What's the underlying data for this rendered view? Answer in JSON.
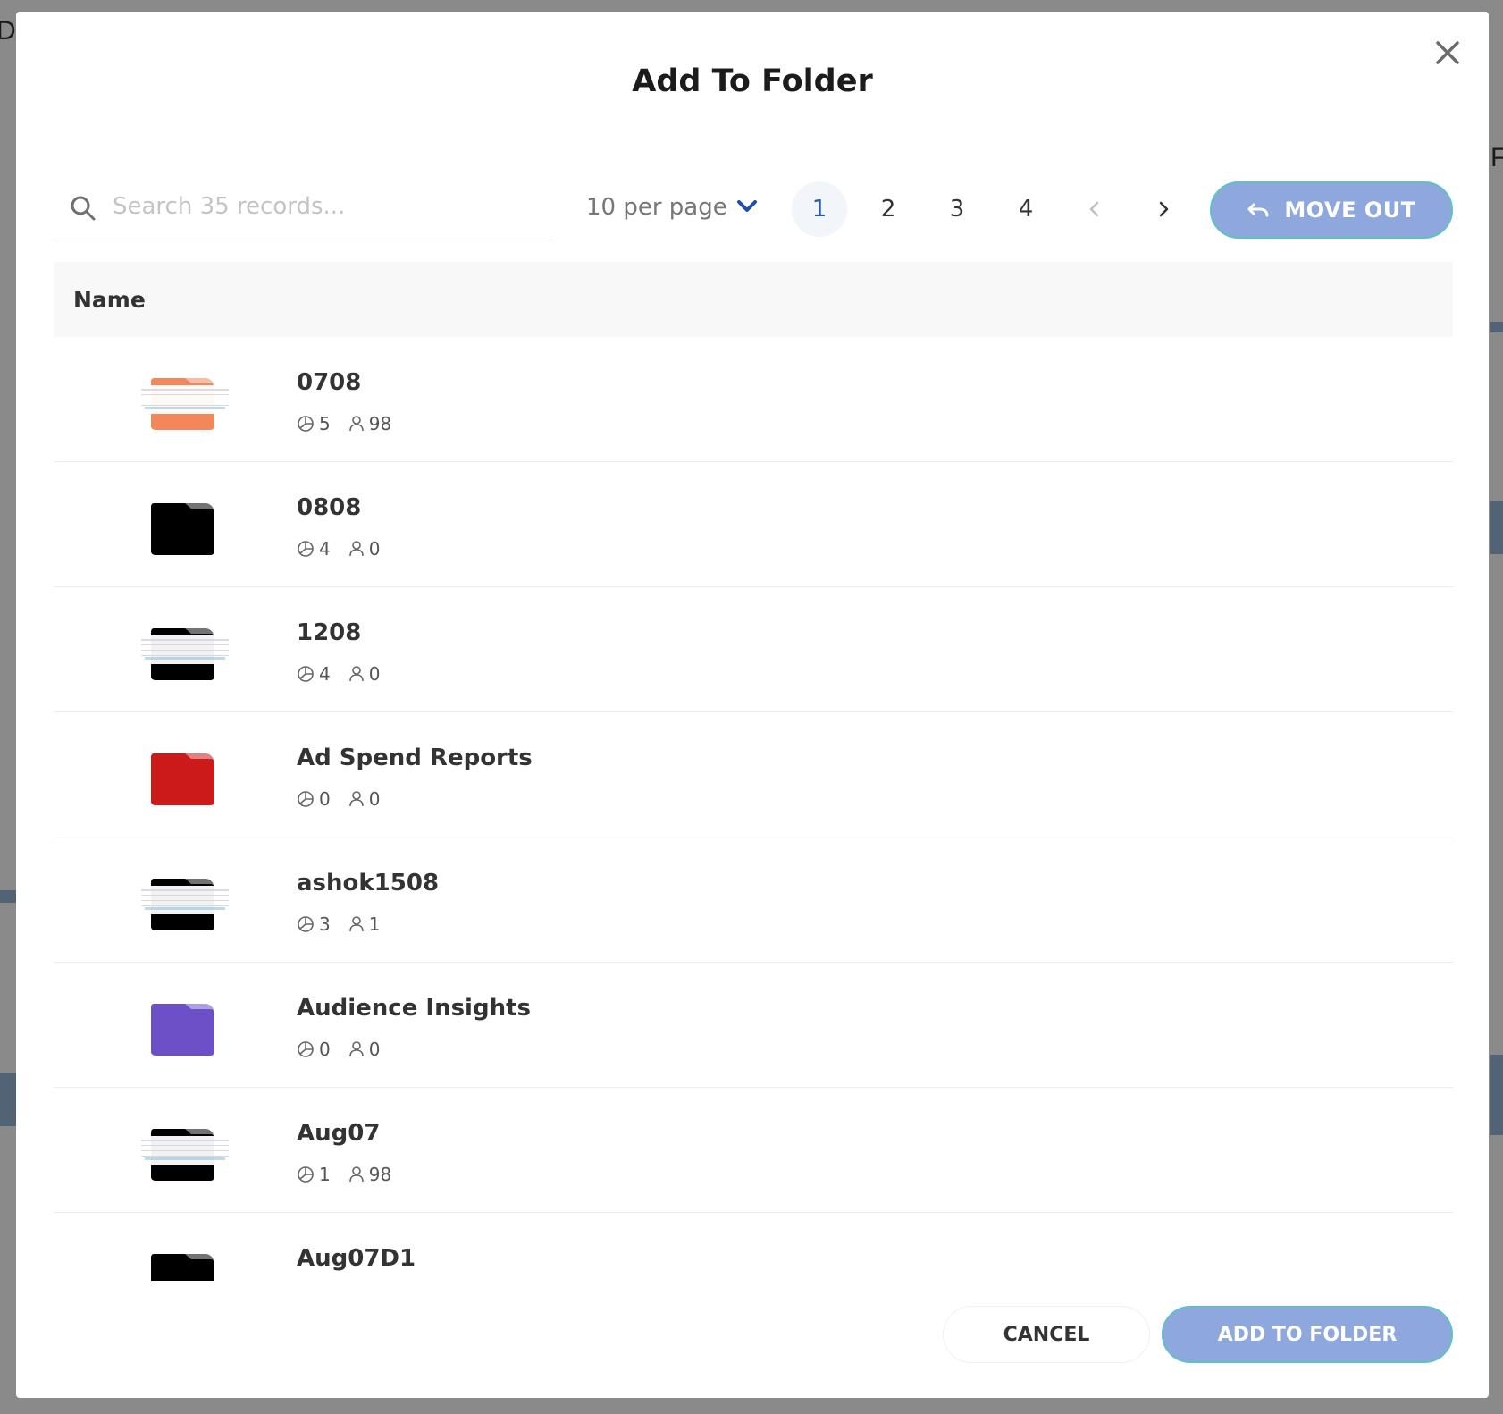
{
  "modal": {
    "title": "Add To Folder"
  },
  "search": {
    "placeholder": "Search 35 records...",
    "value": ""
  },
  "pagination": {
    "per_page_label": "10 per page",
    "pages": [
      "1",
      "2",
      "3",
      "4"
    ],
    "current_page": "1"
  },
  "actions": {
    "move_out_label": "MOVE OUT",
    "cancel_label": "CANCEL",
    "add_to_folder_label": "ADD TO FOLDER"
  },
  "table": {
    "header_name": "Name",
    "rows": [
      {
        "name": "0708",
        "charts": "5",
        "users": "98",
        "thumb": "preview",
        "color": "#f4875a"
      },
      {
        "name": "0808",
        "charts": "4",
        "users": "0",
        "thumb": "folder",
        "color": "#000000"
      },
      {
        "name": "1208",
        "charts": "4",
        "users": "0",
        "thumb": "preview",
        "color": "#000000"
      },
      {
        "name": "Ad Spend Reports",
        "charts": "0",
        "users": "0",
        "thumb": "folder",
        "color": "#cc1a1a"
      },
      {
        "name": "ashok1508",
        "charts": "3",
        "users": "1",
        "thumb": "preview",
        "color": "#000000"
      },
      {
        "name": "Audience Insights",
        "charts": "0",
        "users": "0",
        "thumb": "folder",
        "color": "#6b50c8"
      },
      {
        "name": "Aug07",
        "charts": "1",
        "users": "98",
        "thumb": "preview",
        "color": "#000000"
      },
      {
        "name": "Aug07D1",
        "charts": "",
        "users": "",
        "thumb": "folder",
        "color": "#000000"
      }
    ]
  },
  "colors": {
    "primary_button": "#8ea7dd",
    "active_page": "#2a5caa",
    "chevron": "#1f4fa8"
  }
}
